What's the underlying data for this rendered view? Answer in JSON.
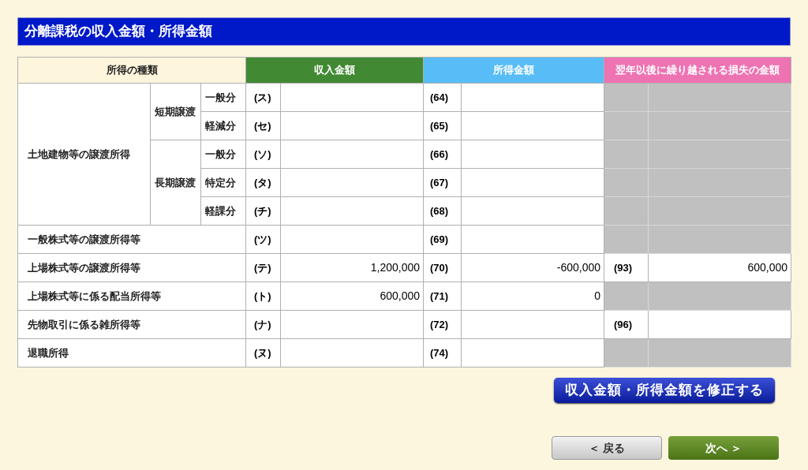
{
  "title": "分離課税の収入金額・所得金額",
  "columns": [
    {
      "label": "所得の種類",
      "kind": "type"
    },
    {
      "label": "収入金額",
      "kind": "revenue"
    },
    {
      "label": "所得金額",
      "kind": "income"
    },
    {
      "label": "翌年以後に繰り越される損失の金額",
      "kind": "loss"
    }
  ],
  "rows": [
    {
      "label": "土地建物等の譲渡所得",
      "children": [
        {
          "label": "短期譲渡",
          "children": [
            {
              "label": "一般分",
              "revenue_code": "(ス)",
              "income_code": "(64)",
              "loss_available": false
            },
            {
              "label": "軽減分",
              "revenue_code": "(セ)",
              "income_code": "(65)",
              "loss_available": false
            }
          ]
        },
        {
          "label": "長期譲渡",
          "children": [
            {
              "label": "一般分",
              "revenue_code": "(ソ)",
              "income_code": "(66)",
              "loss_available": false
            },
            {
              "label": "特定分",
              "revenue_code": "(タ)",
              "income_code": "(67)",
              "loss_available": false
            },
            {
              "label": "軽課分",
              "revenue_code": "(チ)",
              "income_code": "(68)",
              "loss_available": false
            }
          ]
        }
      ]
    },
    {
      "label": "一般株式等の譲渡所得等",
      "revenue_code": "(ツ)",
      "income_code": "(69)",
      "loss_available": false
    },
    {
      "label": "上場株式等の譲渡所得等",
      "revenue_code": "(テ)",
      "revenue": "1,200,000",
      "income_code": "(70)",
      "income": "-600,000",
      "loss_available": true,
      "loss_code": "(93)",
      "loss": "600,000"
    },
    {
      "label": "上場株式等に係る配当所得等",
      "revenue_code": "(ト)",
      "revenue": "600,000",
      "income_code": "(71)",
      "income": "0",
      "loss_available": false
    },
    {
      "label": "先物取引に係る雑所得等",
      "revenue_code": "(ナ)",
      "income_code": "(72)",
      "loss_available": true,
      "loss_code": "(96)"
    },
    {
      "label": "退職所得",
      "revenue_code": "(ヌ)",
      "income_code": "(74)",
      "loss_available": false
    }
  ],
  "edit_button": "収入金額・所得金額を修正する",
  "back_button": "＜ 戻る",
  "next_button": "次へ ＞"
}
